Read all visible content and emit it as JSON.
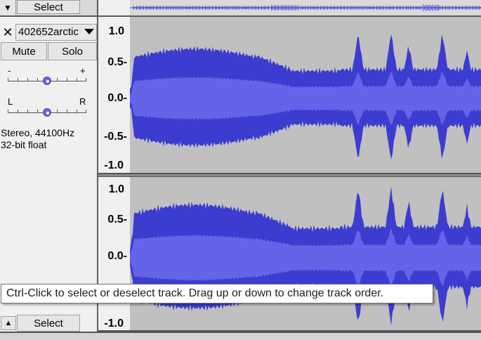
{
  "top_bar": {
    "select_label": "Select",
    "collapse_icon": "triangle-down-icon"
  },
  "track": {
    "name": "402652arctic",
    "close_icon": "close-icon",
    "dropdown_icon": "triangle-down-icon",
    "mute_label": "Mute",
    "solo_label": "Solo",
    "gain_slider": {
      "minus_label": "-",
      "plus_label": "+",
      "value": 0.5
    },
    "pan_slider": {
      "left_label": "L",
      "right_label": "R",
      "value": 0.5
    },
    "format_line1": "Stereo, 44100Hz",
    "format_line2": "32-bit float",
    "select_label": "Select",
    "collapse_icon": "triangle-up-icon"
  },
  "ruler": {
    "ch1": [
      "1.0",
      "0.5-",
      "0.0-",
      "-0.5-",
      "-1.0"
    ],
    "ch2": [
      "1.0",
      "0.5-",
      "0.0-",
      "-1.0"
    ]
  },
  "tooltip": {
    "text": "Ctrl-Click to select or deselect track. Drag up or down to change track order."
  },
  "colors": {
    "waveform": "#3c3cd0",
    "waveform_rms": "#6464e8",
    "background": "#c0c0c0",
    "panel": "#f0f0f0"
  }
}
